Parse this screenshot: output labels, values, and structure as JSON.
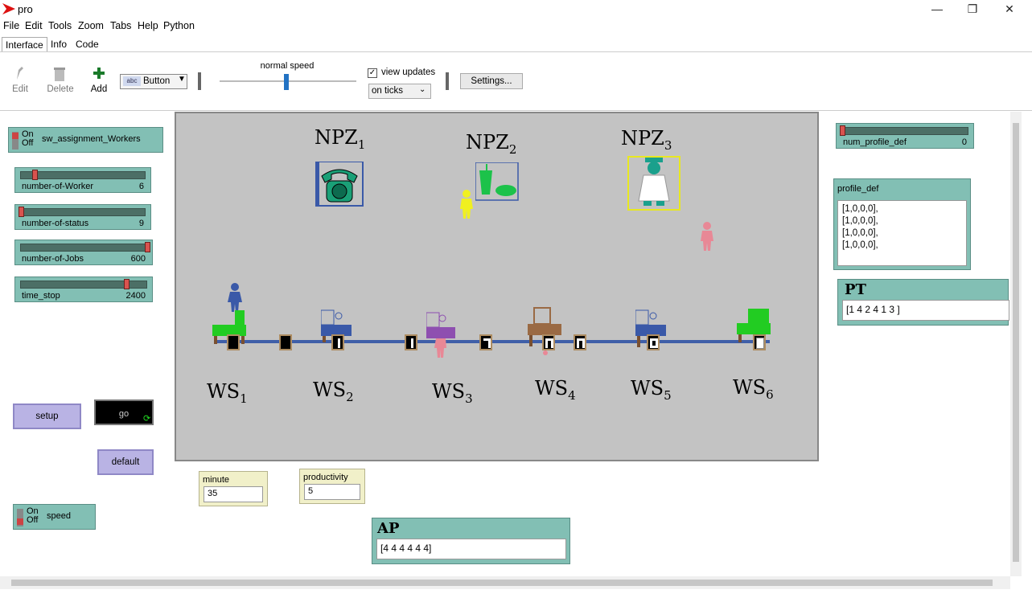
{
  "window": {
    "title": "pro",
    "controls": [
      "—",
      "❐",
      "✕"
    ]
  },
  "menu": [
    "File",
    "Edit",
    "Tools",
    "Zoom",
    "Tabs",
    "Help",
    "Python"
  ],
  "tabs": [
    "Interface",
    "Info",
    "Code"
  ],
  "toolbar": {
    "edit": "Edit",
    "delete": "Delete",
    "add": "Add",
    "widget_type": "Button",
    "speed_label": "normal speed",
    "view_updates": "view updates",
    "update_mode": "on ticks",
    "settings": "Settings..."
  },
  "switches": {
    "sw_assignment": {
      "on": "On",
      "off": "Off",
      "label": "sw_assignment_Workers"
    },
    "speed": {
      "on": "On",
      "off": "Off",
      "label": "speed"
    }
  },
  "sliders": [
    {
      "label": "number-of-Worker",
      "value": "6",
      "fraction": 0.1
    },
    {
      "label": "number-of-status",
      "value": "9",
      "fraction": 0.0
    },
    {
      "label": "number-of-Jobs",
      "value": "600",
      "fraction": 1.0
    },
    {
      "label": "time_stop",
      "value": "2400",
      "fraction": 0.83
    },
    {
      "label": "num_profile_def",
      "value": "0",
      "fraction": 0.0
    }
  ],
  "buttons": {
    "setup": "setup",
    "go": "go",
    "default": "default"
  },
  "world": {
    "npz": [
      {
        "name": "NPZ",
        "sub": "1"
      },
      {
        "name": "NPZ",
        "sub": "2"
      },
      {
        "name": "NPZ",
        "sub": "3"
      }
    ],
    "ws": [
      {
        "name": "WS",
        "sub": "1"
      },
      {
        "name": "WS",
        "sub": "2"
      },
      {
        "name": "WS",
        "sub": "3"
      },
      {
        "name": "WS",
        "sub": "4"
      },
      {
        "name": "WS",
        "sub": "5"
      },
      {
        "name": "WS",
        "sub": "6"
      }
    ]
  },
  "profile_def": {
    "label": "profile_def",
    "lines": [
      "[1,0,0,0],",
      "[1,0,0,0],",
      "[1,0,0,0],",
      "[1,0,0,0],"
    ]
  },
  "pt": {
    "label": "PT",
    "value": "[1 4 2 4 1 3 ]"
  },
  "ap": {
    "label": "AP",
    "value": "[4 4 4 4 4 4]"
  },
  "monitors": {
    "minute": {
      "label": "minute",
      "value": "35"
    },
    "productivity": {
      "label": "productivity",
      "value": "5"
    }
  },
  "colors": {
    "widget": "#82bfb4",
    "button": "#b9b3e4",
    "world_bg": "#c3c3c3",
    "line": "#3f5fa8"
  }
}
